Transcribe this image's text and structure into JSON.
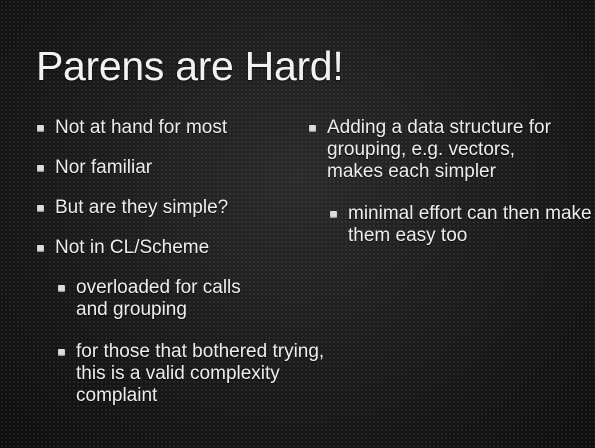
{
  "slide": {
    "title": "Parens are Hard!",
    "left_bullets": [
      "Not at hand for most",
      "Nor familiar",
      "But are they simple?",
      "Not in CL/Scheme"
    ],
    "left_sub_bullets": [
      "overloaded for calls and grouping",
      "for those that bothered trying, this is a valid complexity complaint"
    ],
    "right_bullets": [
      "Adding a data structure for grouping, e.g. vectors, makes each simpler"
    ],
    "right_sub_bullets": [
      "minimal effort can then make them easy too"
    ]
  }
}
